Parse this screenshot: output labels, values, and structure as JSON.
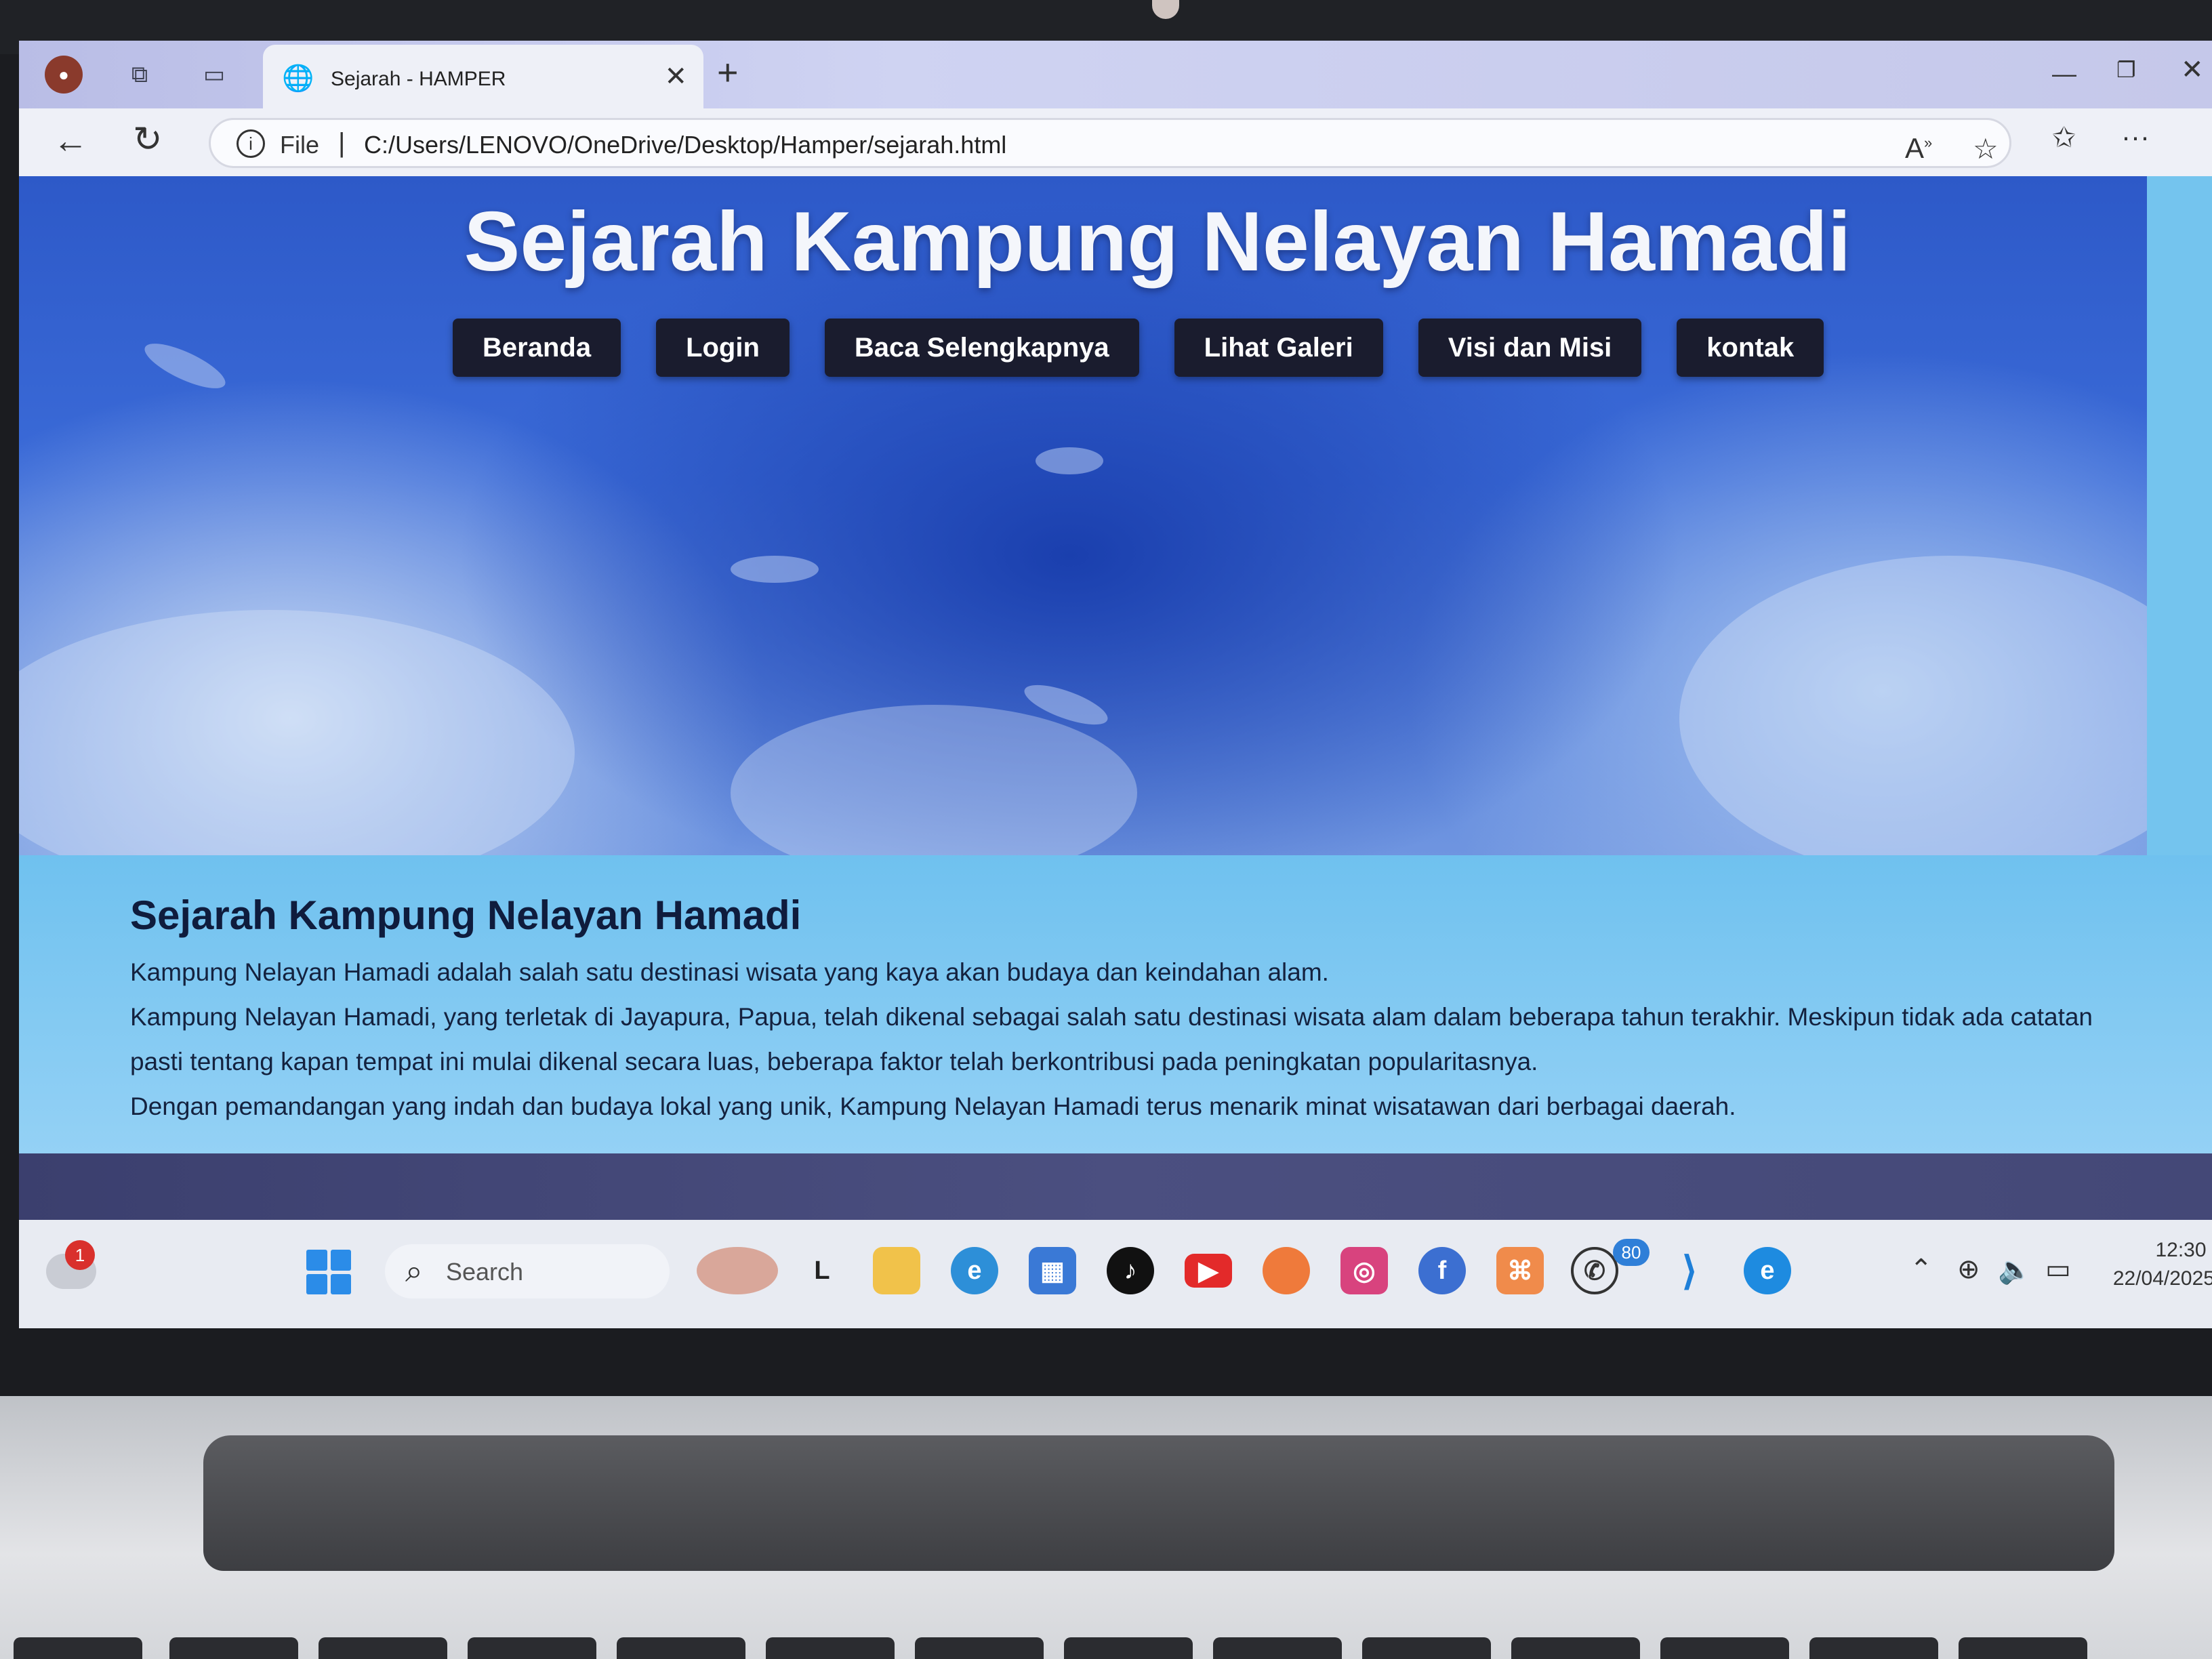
{
  "browser": {
    "tab_title": "Sejarah - HAMPER",
    "address_scheme": "File",
    "url_separator": "|",
    "url": "C:/Users/LENOVO/OneDrive/Desktop/Hamper/sejarah.html"
  },
  "page": {
    "heading": "Sejarah Kampung Nelayan Hamadi",
    "nav": [
      {
        "label": "Beranda"
      },
      {
        "label": "Login"
      },
      {
        "label": "Baca Selengkapnya"
      },
      {
        "label": "Lihat Galeri"
      },
      {
        "label": "Visi dan Misi"
      },
      {
        "label": "kontak"
      }
    ],
    "section_title": "Sejarah Kampung Nelayan Hamadi",
    "paragraphs": [
      "Kampung Nelayan Hamadi adalah salah satu destinasi wisata yang kaya akan budaya dan keindahan alam.",
      "Kampung Nelayan Hamadi, yang terletak di Jayapura, Papua, telah dikenal sebagai salah satu destinasi wisata alam dalam beberapa tahun terakhir. Meskipun tidak ada catatan pasti tentang kapan tempat ini mulai dikenal secara luas, beberapa faktor telah berkontribusi pada peningkatan popularitasnya.",
      "Dengan pemandangan yang indah dan budaya lokal yang unik, Kampung Nelayan Hamadi terus menarik minat wisatawan dari berbagai daerah."
    ]
  },
  "taskbar": {
    "notification_count": "1",
    "search_placeholder": "Search",
    "whatsapp_badge": "80",
    "time": "12:30",
    "date": "22/04/2025",
    "apps": [
      "copilot-icon",
      "files-icon",
      "file-explorer-icon",
      "edge-icon",
      "microsoft-store-icon",
      "tiktok-icon",
      "youtube-icon",
      "firefox-icon",
      "instagram-icon",
      "facebook-icon",
      "xampp-icon",
      "whatsapp-icon",
      "vscode-icon",
      "edge-dev-icon"
    ]
  },
  "colors": {
    "nav_button": "#1a1c2e",
    "page_background": "#74c4ee",
    "footer_band": "#444877"
  }
}
